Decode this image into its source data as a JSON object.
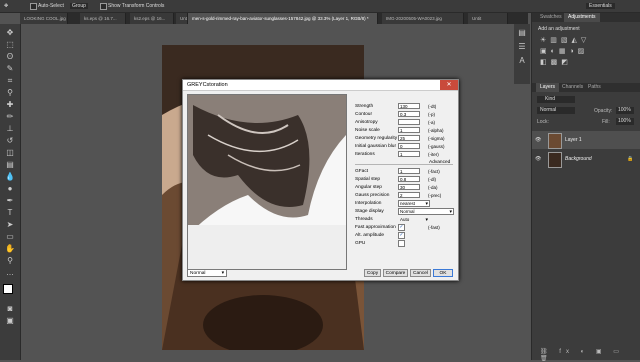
{
  "options_bar": {
    "auto_select_label": "Auto-Select",
    "group_value": "Group",
    "show_transform_label": "Show Transform Controls",
    "workspace_value": "Essentials"
  },
  "tabs": [
    {
      "label": "LOOKING COOL.jpg"
    },
    {
      "label": "ks.eps @ 16.7..."
    },
    {
      "label": "ks2.eps @ 16..."
    },
    {
      "label": "Untitled-1 ..."
    },
    {
      "label": "men-s-gold-rimmed-ray-ban-aviator-sunglasses-157842.jpg @ 33.3% (Layer 1, RGB/8) *"
    },
    {
      "label": "IMG-20200505-WA0023.jpg"
    },
    {
      "label": "Untit"
    }
  ],
  "panels": {
    "tabs": [
      "Swatches",
      "Adjustments"
    ],
    "add_adjustment": "Add an adjustment",
    "layers_tabs": [
      "Layers",
      "Channels",
      "Paths"
    ],
    "kind_value": "Kind",
    "blend_value": "Normal",
    "opacity_label": "Opacity:",
    "opacity_value": "100%",
    "lock_label": "Lock:",
    "fill_label": "Fill:",
    "fill_value": "100%",
    "layers": [
      {
        "name": "Layer 1"
      },
      {
        "name": "Background"
      }
    ]
  },
  "dialog": {
    "title": "GREYCstoration",
    "params": [
      {
        "label": "Strength",
        "value": "130",
        "unit": "(-dt)"
      },
      {
        "label": "Contour",
        "value": "0.3",
        "unit": "(-p)"
      },
      {
        "label": "Anisotropy",
        "value": "",
        "unit": "(-a)"
      },
      {
        "label": "Noise scale",
        "value": "1",
        "unit": "(-alpha)"
      },
      {
        "label": "Geometry regularity",
        "value": "25",
        "unit": "(-sigma)"
      },
      {
        "label": "Initial gaussian blur",
        "value": "0",
        "unit": "(-gauss)"
      },
      {
        "label": "Iterations",
        "value": "1",
        "unit": "(-iter)"
      }
    ],
    "advanced_label": "Advanced",
    "adv_params": [
      {
        "label": "GFact",
        "value": "1",
        "unit": "(-fact)"
      },
      {
        "label": "Spatial step",
        "value": "0.8",
        "unit": "(-dl)"
      },
      {
        "label": "Angular step",
        "value": "30",
        "unit": "(-da)"
      },
      {
        "label": "Gauss precision",
        "value": "2",
        "unit": "(-prec)"
      }
    ],
    "interpolation_label": "Interpolation",
    "interpolation_value": "nearest",
    "stage_display_label": "Stage display",
    "stage_display_value": "Normal",
    "threads_label": "Threads",
    "threads_value": "Auto",
    "fast_approx_label": "Fast approximation",
    "fast_approx_unit": "(-fast)",
    "alt_amplitude_label": "Alt. amplitude",
    "gpu_label": "GPU",
    "preview_mode_value": "Normal",
    "buttons": {
      "copy": "Copy",
      "compare": "Compare",
      "cancel": "Cancel",
      "ok": "OK"
    },
    "close_glyph": "✕"
  },
  "colors": {
    "accent": "#3b79d6",
    "close": "#c94a3b",
    "app_bg": "#535353"
  }
}
